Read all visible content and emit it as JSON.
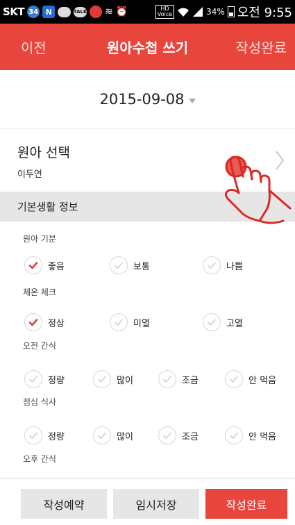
{
  "status_bar": {
    "carrier": "SKT",
    "badge_count": "34",
    "hd_label_top": "HD",
    "hd_label_bottom": "Voice",
    "battery": "34%",
    "time": "오전 9:55"
  },
  "header": {
    "back_label": "이전",
    "title": "원아수첩 쓰기",
    "done_label": "작성완료"
  },
  "date": {
    "value": "2015-09-08"
  },
  "child_select": {
    "title": "원아 선택",
    "name": "이두연"
  },
  "section_title": "기본생활 정보",
  "groups": [
    {
      "label": "원아 기분",
      "options": [
        {
          "label": "좋음",
          "checked": true
        },
        {
          "label": "보통",
          "checked": false
        },
        {
          "label": "나쁨",
          "checked": false
        }
      ]
    },
    {
      "label": "체온 체크",
      "options": [
        {
          "label": "정상",
          "checked": true
        },
        {
          "label": "미열",
          "checked": false
        },
        {
          "label": "고열",
          "checked": false
        }
      ]
    },
    {
      "label": "오전 간식",
      "options": [
        {
          "label": "정량",
          "checked": false
        },
        {
          "label": "많이",
          "checked": false
        },
        {
          "label": "조금",
          "checked": false
        },
        {
          "label": "안 먹음",
          "checked": false
        }
      ]
    },
    {
      "label": "점심 식사",
      "options": [
        {
          "label": "정량",
          "checked": false
        },
        {
          "label": "많이",
          "checked": false
        },
        {
          "label": "조금",
          "checked": false
        },
        {
          "label": "안 먹음",
          "checked": false
        }
      ]
    },
    {
      "label": "오후 간식",
      "options": []
    }
  ],
  "bottom_bar": {
    "reserve_label": "작성예약",
    "temp_save_label": "임시저장",
    "complete_label": "작성완료"
  },
  "colors": {
    "accent": "#e8453c",
    "check_on": "#e53935",
    "check_off": "#cfcfcf"
  }
}
